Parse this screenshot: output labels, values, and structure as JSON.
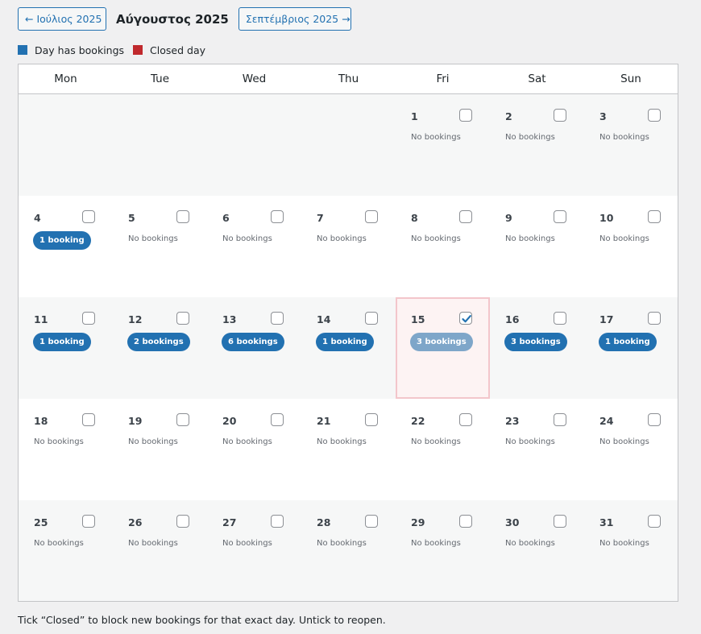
{
  "nav": {
    "prev_label": "← Ιούλιος 2025",
    "title": "Αύγουστος 2025",
    "next_label": "Σεπτέμβριος 2025 →"
  },
  "legend": {
    "bookings_label": "Day has bookings",
    "bookings_color": "#2271b1",
    "closed_label": "Closed day",
    "closed_color": "#c0292d"
  },
  "weekdays": [
    "Mon",
    "Tue",
    "Wed",
    "Thu",
    "Fri",
    "Sat",
    "Sun"
  ],
  "weeks": [
    [
      null,
      null,
      null,
      null,
      {
        "day": "1",
        "status": "No bookings",
        "closed": false
      },
      {
        "day": "2",
        "status": "No bookings",
        "closed": false
      },
      {
        "day": "3",
        "status": "No bookings",
        "closed": false
      }
    ],
    [
      {
        "day": "4",
        "bookings": "1 booking",
        "closed": false
      },
      {
        "day": "5",
        "status": "No bookings",
        "closed": false
      },
      {
        "day": "6",
        "status": "No bookings",
        "closed": false
      },
      {
        "day": "7",
        "status": "No bookings",
        "closed": false
      },
      {
        "day": "8",
        "status": "No bookings",
        "closed": false
      },
      {
        "day": "9",
        "status": "No bookings",
        "closed": false
      },
      {
        "day": "10",
        "status": "No bookings",
        "closed": false
      }
    ],
    [
      {
        "day": "11",
        "bookings": "1 booking",
        "closed": false
      },
      {
        "day": "12",
        "bookings": "2 bookings",
        "closed": false
      },
      {
        "day": "13",
        "bookings": "6 bookings",
        "closed": false
      },
      {
        "day": "14",
        "bookings": "1 booking",
        "closed": false
      },
      {
        "day": "15",
        "bookings": "3 bookings",
        "closed": true
      },
      {
        "day": "16",
        "bookings": "3 bookings",
        "closed": false
      },
      {
        "day": "17",
        "bookings": "1 booking",
        "closed": false
      }
    ],
    [
      {
        "day": "18",
        "status": "No bookings",
        "closed": false
      },
      {
        "day": "19",
        "status": "No bookings",
        "closed": false
      },
      {
        "day": "20",
        "status": "No bookings",
        "closed": false
      },
      {
        "day": "21",
        "status": "No bookings",
        "closed": false
      },
      {
        "day": "22",
        "status": "No bookings",
        "closed": false
      },
      {
        "day": "23",
        "status": "No bookings",
        "closed": false
      },
      {
        "day": "24",
        "status": "No bookings",
        "closed": false
      }
    ],
    [
      {
        "day": "25",
        "status": "No bookings",
        "closed": false
      },
      {
        "day": "26",
        "status": "No bookings",
        "closed": false
      },
      {
        "day": "27",
        "status": "No bookings",
        "closed": false
      },
      {
        "day": "28",
        "status": "No bookings",
        "closed": false
      },
      {
        "day": "29",
        "status": "No bookings",
        "closed": false
      },
      {
        "day": "30",
        "status": "No bookings",
        "closed": false
      },
      {
        "day": "31",
        "status": "No bookings",
        "closed": false
      }
    ]
  ],
  "footer": "Tick “Closed” to block new bookings for that exact day. Untick to reopen."
}
